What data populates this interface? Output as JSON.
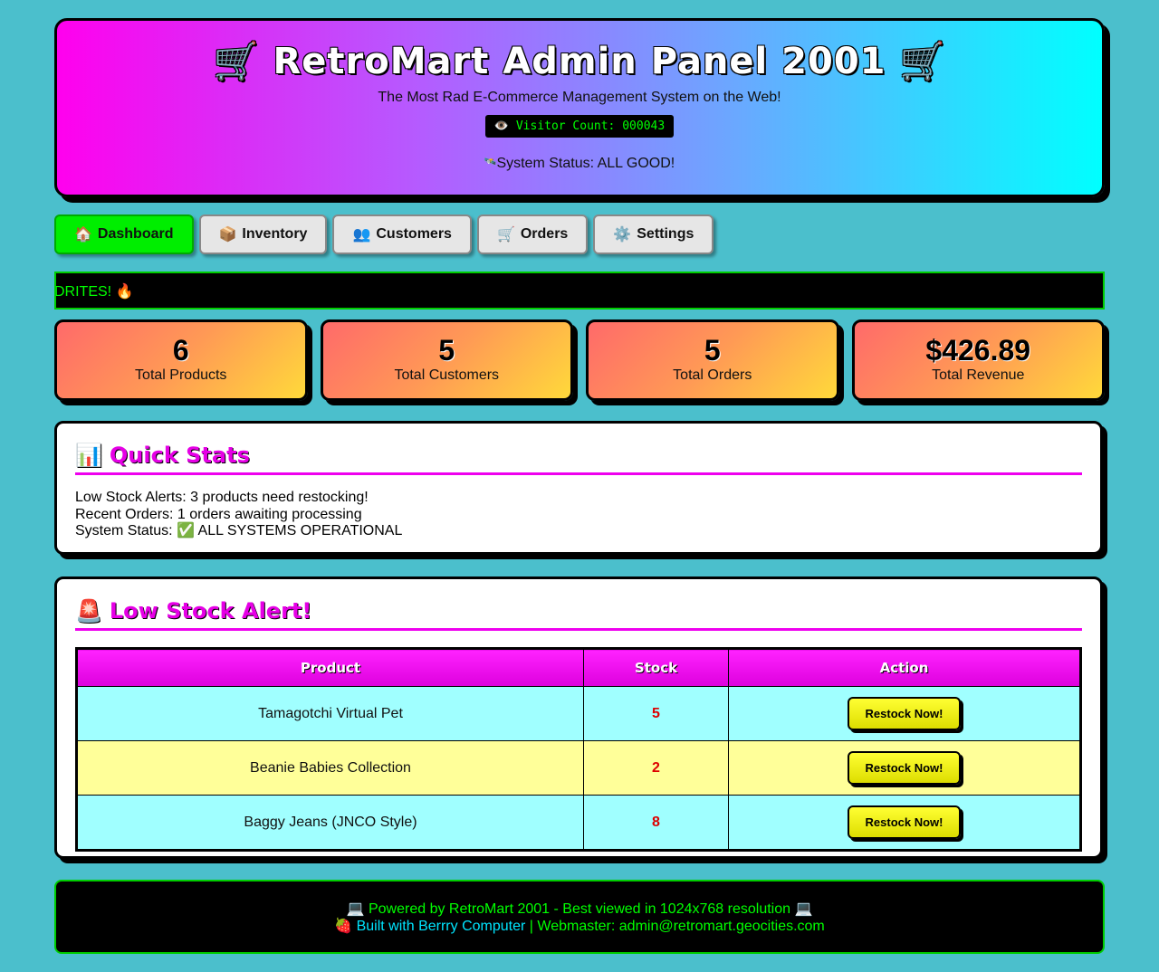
{
  "header": {
    "title": "RetroMart Admin Panel 2001",
    "cart_icon": "🛒",
    "subtitle": "The Most Rad E-Commerce Management System on the Web!",
    "visitor_icon": "👁️",
    "visitor_count": "Visitor Count: 000043",
    "status_icon": "🛰️",
    "status_text": "System Status: ALL GOOD!"
  },
  "nav": {
    "tabs": [
      {
        "icon": "🏠",
        "label": "Dashboard"
      },
      {
        "icon": "📦",
        "label": "Inventory"
      },
      {
        "icon": "👥",
        "label": "Customers"
      },
      {
        "icon": "🛒",
        "label": "Orders"
      },
      {
        "icon": "⚙️",
        "label": "Settings"
      }
    ]
  },
  "marquee": {
    "text": "DRITES! 🔥"
  },
  "stats": [
    {
      "value": "6",
      "label": "Total Products"
    },
    {
      "value": "5",
      "label": "Total Customers"
    },
    {
      "value": "5",
      "label": "Total Orders"
    },
    {
      "value": "$426.89",
      "label": "Total Revenue"
    }
  ],
  "quick_stats": {
    "icon": "📊",
    "title": "Quick Stats",
    "low_stock": "Low Stock Alerts: 3 products need restocking!",
    "recent_orders": "Recent Orders: 1 orders awaiting processing",
    "system_status": "System Status: ✅ ALL SYSTEMS OPERATIONAL"
  },
  "low_stock": {
    "icon": "🚨",
    "title": "Low Stock Alert!",
    "columns": [
      "Product",
      "Stock",
      "Action"
    ],
    "rows": [
      {
        "product": "Tamagotchi Virtual Pet",
        "stock": "5",
        "action": "Restock Now!"
      },
      {
        "product": "Beanie Babies Collection",
        "stock": "2",
        "action": "Restock Now!"
      },
      {
        "product": "Baggy Jeans (JNCO Style)",
        "stock": "8",
        "action": "Restock Now!"
      }
    ]
  },
  "footer": {
    "line1": "💻 Powered by RetroMart 2001 - Best viewed in 1024x768 resolution 💻",
    "line2_icon": "🍓",
    "line2_link": "Built with Berrry Computer",
    "line2_rest": " | Webmaster: admin@retromart.geocities.com"
  },
  "colors": {
    "background": "#4bbfcc",
    "accent_magenta": "#ee00ee",
    "nav_active": "#00ee00",
    "stock_red": "#dd0000",
    "footer_text": "#00ff00",
    "footer_link": "#00e5ff"
  }
}
